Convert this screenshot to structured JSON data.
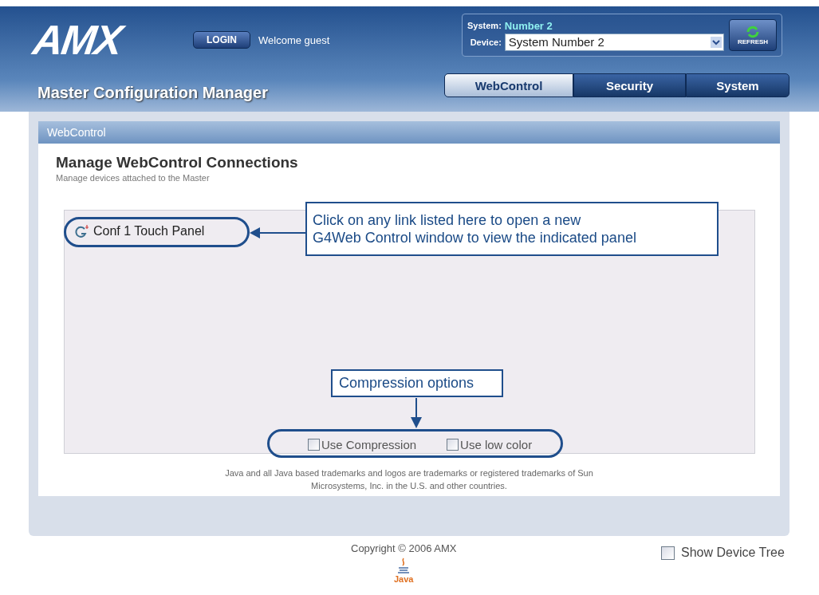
{
  "header": {
    "logo": "AMX",
    "login_button": "LOGIN",
    "welcome": "Welcome guest",
    "title": "Master Configuration Manager"
  },
  "system_box": {
    "system_label": "System:",
    "system_value": "Number 2",
    "device_label": "Device:",
    "device_value": "System Number 2",
    "refresh_button": "REFRESH"
  },
  "tabs": [
    {
      "label": "WebControl",
      "selected": true
    },
    {
      "label": "Security",
      "selected": false
    },
    {
      "label": "System",
      "selected": false
    }
  ],
  "panel": {
    "title": "WebControl",
    "heading": "Manage WebControl Connections",
    "subheading": "Manage devices attached to the Master",
    "links": [
      {
        "label": "Conf 1 Touch Panel"
      }
    ],
    "options": [
      {
        "label": "Use Compression",
        "checked": false
      },
      {
        "label": "Use low color",
        "checked": false
      }
    ],
    "java_notice": "Java and all Java based trademarks and logos are trademarks or registered trademarks of Sun Microsystems, Inc. in the U.S. and other countries."
  },
  "callouts": [
    {
      "lines": [
        "Click on any link listed here to open a new",
        "G4Web Control window to view the indicated panel"
      ]
    },
    {
      "lines": [
        "Compression options"
      ]
    }
  ],
  "footer": {
    "copyright": "Copyright © 2006 AMX",
    "java_logo": "Java",
    "show_device_tree": {
      "label": "Show Device Tree",
      "checked": false
    }
  }
}
